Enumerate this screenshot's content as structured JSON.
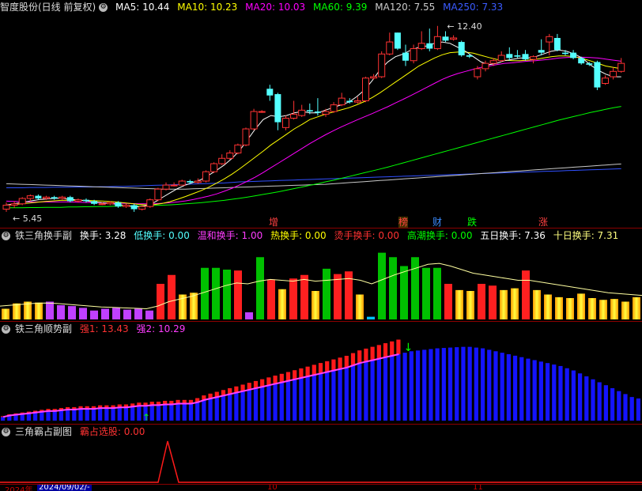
{
  "main_header": {
    "title": "智度股份(日线 前复权)",
    "ma5": "MA5: 10.44",
    "ma10": "MA10: 10.23",
    "ma20": "MA20: 10.03",
    "ma60": "MA60: 9.39",
    "ma120": "MA120: 7.55",
    "ma250": "MA250: 7.33"
  },
  "price_high_label": "12.40",
  "price_low_label": "5.45",
  "event_tags": [
    "增",
    "榜",
    "财",
    "跌",
    "涨"
  ],
  "panel1": {
    "title": "铁三角换手副",
    "huanshou": "换手: 3.28",
    "di": "低换手: 0.00",
    "wenhe": "温和换手: 1.00",
    "re": "热换手: 0.00",
    "tang": "烫手换手: 0.00",
    "gaochao": "高潮换手: 0.00",
    "wuri": "五日换手: 7.36",
    "shiri": "十日换手: 7.31"
  },
  "panel2": {
    "title": "铁三角顺势副",
    "qiang1": "强1: 13.43",
    "qiang2": "强2: 10.29"
  },
  "panel3": {
    "title": "三角霸占副图",
    "bazhan": "霸占选股: 0.00"
  },
  "axis": {
    "year_label": "2024年",
    "date_box": "2024/09/02/-",
    "tick_oct": "10",
    "tick_nov": "11"
  },
  "colors": {
    "up": "#ff3232",
    "down": "#54ffff",
    "ma5": "#ffffff",
    "ma10": "#ffff00",
    "ma20": "#ff00ff",
    "ma60": "#00ff00",
    "ma120": "#c8c8c8",
    "ma250": "#3050ff"
  },
  "candles": [
    {
      "o": 5.55,
      "c": 5.7,
      "h": 5.8,
      "l": 5.45
    },
    {
      "o": 5.7,
      "c": 5.75,
      "h": 5.85,
      "l": 5.6
    },
    {
      "o": 5.75,
      "c": 5.95,
      "h": 6.0,
      "l": 5.7
    },
    {
      "o": 5.95,
      "c": 6.05,
      "h": 6.1,
      "l": 5.85
    },
    {
      "o": 6.05,
      "c": 5.95,
      "h": 6.1,
      "l": 5.9
    },
    {
      "o": 5.95,
      "c": 6.0,
      "h": 6.05,
      "l": 5.9
    },
    {
      "o": 6.0,
      "c": 5.95,
      "h": 6.05,
      "l": 5.9
    },
    {
      "o": 5.95,
      "c": 6.0,
      "h": 6.05,
      "l": 5.9
    },
    {
      "o": 6.0,
      "c": 5.85,
      "h": 6.05,
      "l": 5.8
    },
    {
      "o": 5.85,
      "c": 5.9,
      "h": 5.95,
      "l": 5.8
    },
    {
      "o": 5.9,
      "c": 5.85,
      "h": 5.95,
      "l": 5.8
    },
    {
      "o": 5.85,
      "c": 5.75,
      "h": 5.9,
      "l": 5.7
    },
    {
      "o": 5.75,
      "c": 5.75,
      "h": 5.8,
      "l": 5.7
    },
    {
      "o": 5.75,
      "c": 5.8,
      "h": 5.85,
      "l": 5.7
    },
    {
      "o": 5.8,
      "c": 5.65,
      "h": 5.85,
      "l": 5.6
    },
    {
      "o": 5.65,
      "c": 5.7,
      "h": 5.75,
      "l": 5.6
    },
    {
      "o": 5.7,
      "c": 5.55,
      "h": 5.75,
      "l": 5.45
    },
    {
      "o": 5.55,
      "c": 5.65,
      "h": 5.7,
      "l": 5.5
    },
    {
      "o": 5.65,
      "c": 5.9,
      "h": 5.95,
      "l": 5.6
    },
    {
      "o": 5.9,
      "c": 6.3,
      "h": 6.35,
      "l": 5.85
    },
    {
      "o": 6.3,
      "c": 6.45,
      "h": 6.55,
      "l": 6.25
    },
    {
      "o": 6.45,
      "c": 6.45,
      "h": 6.55,
      "l": 6.4
    },
    {
      "o": 6.45,
      "c": 6.6,
      "h": 6.65,
      "l": 6.45
    },
    {
      "o": 6.6,
      "c": 6.55,
      "h": 6.65,
      "l": 6.5
    },
    {
      "o": 6.55,
      "c": 6.6,
      "h": 6.7,
      "l": 6.5
    },
    {
      "o": 6.6,
      "c": 6.95,
      "h": 7.0,
      "l": 6.55
    },
    {
      "o": 6.95,
      "c": 7.25,
      "h": 7.3,
      "l": 6.9
    },
    {
      "o": 7.25,
      "c": 7.45,
      "h": 7.6,
      "l": 7.2
    },
    {
      "o": 7.45,
      "c": 7.65,
      "h": 7.75,
      "l": 7.4
    },
    {
      "o": 7.65,
      "c": 7.95,
      "h": 8.0,
      "l": 7.6
    },
    {
      "o": 7.95,
      "c": 8.55,
      "h": 8.6,
      "l": 7.9
    },
    {
      "o": 8.55,
      "c": 9.2,
      "h": 9.3,
      "l": 8.5
    },
    {
      "o": 9.2,
      "c": 9.2,
      "h": 9.25,
      "l": 9.15
    },
    {
      "o": 10.05,
      "c": 9.8,
      "h": 10.2,
      "l": 9.6
    },
    {
      "o": 9.85,
      "c": 8.8,
      "h": 9.9,
      "l": 8.5
    },
    {
      "o": 8.6,
      "c": 8.95,
      "h": 9.05,
      "l": 8.5
    },
    {
      "o": 8.95,
      "c": 9.1,
      "h": 9.6,
      "l": 8.9
    },
    {
      "o": 9.05,
      "c": 9.25,
      "h": 9.45,
      "l": 9.0
    },
    {
      "o": 9.25,
      "c": 9.2,
      "h": 9.5,
      "l": 9.1
    },
    {
      "o": 9.2,
      "c": 9.15,
      "h": 9.7,
      "l": 9.05
    },
    {
      "o": 9.1,
      "c": 9.2,
      "h": 9.3,
      "l": 9.0
    },
    {
      "o": 9.2,
      "c": 9.45,
      "h": 9.55,
      "l": 9.15
    },
    {
      "o": 9.45,
      "c": 9.7,
      "h": 9.9,
      "l": 9.4
    },
    {
      "o": 9.6,
      "c": 9.55,
      "h": 9.7,
      "l": 9.5
    },
    {
      "o": 9.55,
      "c": 9.6,
      "h": 9.75,
      "l": 9.5
    },
    {
      "o": 9.6,
      "c": 10.45,
      "h": 10.5,
      "l": 9.55
    },
    {
      "o": 10.45,
      "c": 10.5,
      "h": 10.6,
      "l": 10.4
    },
    {
      "o": 10.5,
      "c": 11.35,
      "h": 11.45,
      "l": 10.45
    },
    {
      "o": 11.35,
      "c": 11.8,
      "h": 12.15,
      "l": 11.3
    },
    {
      "o": 12.15,
      "c": 11.55,
      "h": 12.15,
      "l": 11.5
    },
    {
      "o": 11.4,
      "c": 11.1,
      "h": 11.7,
      "l": 10.9
    },
    {
      "o": 11.1,
      "c": 11.55,
      "h": 11.7,
      "l": 11.0
    },
    {
      "o": 11.55,
      "c": 11.75,
      "h": 12.2,
      "l": 11.5
    },
    {
      "o": 11.75,
      "c": 11.55,
      "h": 12.3,
      "l": 11.45
    },
    {
      "o": 11.55,
      "c": 12.0,
      "h": 12.4,
      "l": 11.5
    },
    {
      "o": 12.0,
      "c": 11.85,
      "h": 12.2,
      "l": 11.8
    },
    {
      "o": 11.9,
      "c": 11.95,
      "h": 12.05,
      "l": 11.85
    },
    {
      "o": 11.8,
      "c": 11.3,
      "h": 11.85,
      "l": 11.25
    },
    {
      "o": 11.3,
      "c": 11.25,
      "h": 11.35,
      "l": 11.2
    },
    {
      "o": 10.5,
      "c": 10.8,
      "h": 10.9,
      "l": 10.4
    },
    {
      "o": 10.8,
      "c": 11.0,
      "h": 11.1,
      "l": 10.7
    },
    {
      "o": 11.0,
      "c": 11.1,
      "h": 11.2,
      "l": 10.9
    },
    {
      "o": 11.1,
      "c": 11.3,
      "h": 11.45,
      "l": 11.05
    },
    {
      "o": 11.35,
      "c": 11.2,
      "h": 11.6,
      "l": 11.1
    },
    {
      "o": 11.3,
      "c": 11.25,
      "h": 11.5,
      "l": 11.2
    },
    {
      "o": 11.35,
      "c": 11.15,
      "h": 11.5,
      "l": 11.1
    },
    {
      "o": 11.15,
      "c": 11.25,
      "h": 11.3,
      "l": 11.0
    },
    {
      "o": 11.5,
      "c": 11.4,
      "h": 11.9,
      "l": 11.3
    },
    {
      "o": 11.8,
      "c": 12.0,
      "h": 12.1,
      "l": 11.3
    },
    {
      "o": 11.95,
      "c": 11.5,
      "h": 12.1,
      "l": 11.45
    },
    {
      "o": 11.4,
      "c": 11.35,
      "h": 11.5,
      "l": 11.3
    },
    {
      "o": 11.4,
      "c": 11.2,
      "h": 11.5,
      "l": 11.15
    },
    {
      "o": 11.2,
      "c": 11.0,
      "h": 11.25,
      "l": 10.95
    },
    {
      "o": 11.0,
      "c": 10.95,
      "h": 11.05,
      "l": 10.9
    },
    {
      "o": 11.05,
      "c": 10.1,
      "h": 11.1,
      "l": 10.0
    },
    {
      "o": 10.25,
      "c": 10.45,
      "h": 10.55,
      "l": 10.2
    },
    {
      "o": 10.5,
      "c": 10.7,
      "h": 10.85,
      "l": 10.4
    },
    {
      "o": 10.7,
      "c": 11.0,
      "h": 11.2,
      "l": 10.65
    }
  ],
  "ma_lines": {
    "ma5": [
      5.7,
      5.75,
      5.8,
      5.85,
      5.9,
      5.93,
      5.95,
      5.96,
      5.92,
      5.9,
      5.87,
      5.83,
      5.8,
      5.77,
      5.74,
      5.7,
      5.66,
      5.64,
      5.68,
      5.8,
      5.98,
      6.15,
      6.32,
      6.45,
      6.55,
      6.65,
      6.82,
      7.0,
      7.2,
      7.45,
      7.75,
      8.15,
      8.55,
      8.9,
      9.05,
      9.0,
      9.05,
      9.15,
      9.2,
      9.15,
      9.15,
      9.25,
      9.35,
      9.45,
      9.55,
      9.75,
      10.0,
      10.35,
      10.75,
      11.05,
      11.25,
      11.35,
      11.5,
      11.6,
      11.65,
      11.75,
      11.8,
      11.75,
      11.6,
      11.45,
      11.25,
      11.05,
      10.95,
      11.0,
      11.1,
      11.15,
      11.2,
      11.2,
      11.25,
      11.35,
      11.45,
      11.5,
      11.45,
      11.35,
      11.2,
      10.95,
      10.75,
      10.6,
      10.5,
      10.5
    ],
    "ma10": [
      5.7,
      5.72,
      5.75,
      5.78,
      5.81,
      5.84,
      5.86,
      5.88,
      5.88,
      5.88,
      5.88,
      5.87,
      5.86,
      5.84,
      5.82,
      5.79,
      5.76,
      5.73,
      5.71,
      5.72,
      5.76,
      5.83,
      5.92,
      6.02,
      6.13,
      6.24,
      6.37,
      6.52,
      6.68,
      6.86,
      7.06,
      7.28,
      7.5,
      7.72,
      7.95,
      8.15,
      8.35,
      8.55,
      8.72,
      8.9,
      9.0,
      9.1,
      9.18,
      9.26,
      9.34,
      9.45,
      9.57,
      9.72,
      9.9,
      10.1,
      10.3,
      10.5,
      10.7,
      10.9,
      11.05,
      11.2,
      11.32,
      11.4,
      11.42,
      11.42,
      11.38,
      11.3,
      11.22,
      11.15,
      11.12,
      11.1,
      11.1,
      11.12,
      11.15,
      11.2,
      11.25,
      11.28,
      11.28,
      11.25,
      11.18,
      11.1,
      11.0,
      10.9,
      10.85,
      10.8
    ],
    "ma20": [
      5.85,
      5.84,
      5.83,
      5.82,
      5.82,
      5.82,
      5.82,
      5.82,
      5.82,
      5.81,
      5.8,
      5.8,
      5.79,
      5.78,
      5.77,
      5.77,
      5.76,
      5.75,
      5.75,
      5.75,
      5.77,
      5.79,
      5.82,
      5.86,
      5.91,
      5.97,
      6.04,
      6.12,
      6.22,
      6.33,
      6.46,
      6.6,
      6.75,
      6.92,
      7.1,
      7.28,
      7.46,
      7.64,
      7.82,
      8.0,
      8.17,
      8.33,
      8.48,
      8.62,
      8.75,
      8.88,
      9.0,
      9.12,
      9.25,
      9.38,
      9.52,
      9.66,
      9.8,
      9.95,
      10.1,
      10.25,
      10.4,
      10.52,
      10.62,
      10.7,
      10.78,
      10.85,
      10.9,
      10.95,
      11.0,
      11.02,
      11.05,
      11.08,
      11.1,
      11.13,
      11.16,
      11.2,
      11.22,
      11.23,
      11.23,
      11.22,
      11.2,
      11.16,
      11.12,
      11.08
    ],
    "ma60": [
      5.6,
      5.6,
      5.6,
      5.61,
      5.61,
      5.62,
      5.62,
      5.62,
      5.63,
      5.63,
      5.64,
      5.64,
      5.65,
      5.65,
      5.66,
      5.66,
      5.67,
      5.67,
      5.68,
      5.69,
      5.7,
      5.71,
      5.73,
      5.75,
      5.77,
      5.79,
      5.82,
      5.85,
      5.88,
      5.92,
      5.96,
      6.0,
      6.05,
      6.1,
      6.15,
      6.2,
      6.26,
      6.32,
      6.38,
      6.44,
      6.5,
      6.57,
      6.63,
      6.7,
      6.77,
      6.84,
      6.91,
      6.98,
      7.05,
      7.12,
      7.2,
      7.28,
      7.36,
      7.44,
      7.52,
      7.6,
      7.68,
      7.76,
      7.84,
      7.92,
      8.0,
      8.08,
      8.16,
      8.24,
      8.32,
      8.4,
      8.48,
      8.56,
      8.64,
      8.72,
      8.8,
      8.88,
      8.95,
      9.02,
      9.09,
      9.16,
      9.22,
      9.28,
      9.34,
      9.39
    ],
    "ma120": [
      6.5,
      6.49,
      6.48,
      6.47,
      6.46,
      6.45,
      6.44,
      6.43,
      6.42,
      6.41,
      6.4,
      6.39,
      6.38,
      6.37,
      6.36,
      6.35,
      6.34,
      6.33,
      6.32,
      6.31,
      6.3,
      6.3,
      6.3,
      6.3,
      6.31,
      6.32,
      6.33,
      6.34,
      6.35,
      6.36,
      6.37,
      6.38,
      6.39,
      6.4,
      6.41,
      6.42,
      6.43,
      6.44,
      6.45,
      6.46,
      6.47,
      6.48,
      6.5,
      6.52,
      6.54,
      6.56,
      6.58,
      6.6,
      6.62,
      6.64,
      6.66,
      6.68,
      6.7,
      6.72,
      6.74,
      6.76,
      6.78,
      6.8,
      6.82,
      6.84,
      6.86,
      6.88,
      6.9,
      6.92,
      6.94,
      6.96,
      6.98,
      7.0,
      7.02,
      7.04,
      7.06,
      7.08,
      7.1,
      7.12,
      7.14,
      7.16,
      7.18,
      7.2,
      7.22,
      7.24
    ],
    "ma250": [
      6.35,
      6.35,
      6.35,
      6.36,
      6.36,
      6.36,
      6.37,
      6.37,
      6.37,
      6.38,
      6.38,
      6.38,
      6.39,
      6.39,
      6.4,
      6.4,
      6.41,
      6.42,
      6.43,
      6.44,
      6.45,
      6.46,
      6.47,
      6.48,
      6.49,
      6.5,
      6.51,
      6.52,
      6.53,
      6.55,
      6.57,
      6.58,
      6.59,
      6.6,
      6.61,
      6.62,
      6.63,
      6.64,
      6.65,
      6.66,
      6.67,
      6.68,
      6.69,
      6.7,
      6.71,
      6.72,
      6.73,
      6.74,
      6.75,
      6.76,
      6.77,
      6.78,
      6.79,
      6.8,
      6.81,
      6.82,
      6.83,
      6.84,
      6.85,
      6.86,
      6.87,
      6.88,
      6.89,
      6.9,
      6.91,
      6.92,
      6.93,
      6.94,
      6.95,
      6.96,
      6.97,
      6.98,
      6.99,
      7.0,
      7.01,
      7.02,
      7.03,
      7.04,
      7.05,
      7.06
    ]
  },
  "turnover_bars": [
    {
      "v": 1.2,
      "c": "yellow"
    },
    {
      "v": 1.8,
      "c": "yellow"
    },
    {
      "v": 2.0,
      "c": "yellow"
    },
    {
      "v": 1.9,
      "c": "yellow"
    },
    {
      "v": 2.0,
      "c": "magenta"
    },
    {
      "v": 1.6,
      "c": "magenta"
    },
    {
      "v": 1.5,
      "c": "magenta"
    },
    {
      "v": 1.3,
      "c": "magenta"
    },
    {
      "v": 1.0,
      "c": "magenta"
    },
    {
      "v": 1.2,
      "c": "magenta"
    },
    {
      "v": 1.3,
      "c": "magenta"
    },
    {
      "v": 1.1,
      "c": "magenta"
    },
    {
      "v": 1.2,
      "c": "magenta"
    },
    {
      "v": 1.0,
      "c": "magenta"
    },
    {
      "v": 4.0,
      "c": "red"
    },
    {
      "v": 5.0,
      "c": "red"
    },
    {
      "v": 2.8,
      "c": "yellow"
    },
    {
      "v": 3.0,
      "c": "yellow"
    },
    {
      "v": 5.8,
      "c": "green"
    },
    {
      "v": 5.8,
      "c": "green"
    },
    {
      "v": 5.6,
      "c": "green"
    },
    {
      "v": 5.5,
      "c": "red"
    },
    {
      "v": 0.8,
      "c": "magenta"
    },
    {
      "v": 7.0,
      "c": "green"
    },
    {
      "v": 4.5,
      "c": "red"
    },
    {
      "v": 3.4,
      "c": "yellow"
    },
    {
      "v": 4.6,
      "c": "red"
    },
    {
      "v": 5.0,
      "c": "red"
    },
    {
      "v": 3.2,
      "c": "yellow"
    },
    {
      "v": 5.7,
      "c": "green"
    },
    {
      "v": 5.1,
      "c": "red"
    },
    {
      "v": 5.4,
      "c": "red"
    },
    {
      "v": 2.8,
      "c": "yellow"
    },
    {
      "v": 0.3,
      "c": "cyan"
    },
    {
      "v": 7.5,
      "c": "green"
    },
    {
      "v": 7.0,
      "c": "green"
    },
    {
      "v": 6.0,
      "c": "green"
    },
    {
      "v": 7.0,
      "c": "green"
    },
    {
      "v": 5.8,
      "c": "green"
    },
    {
      "v": 5.8,
      "c": "green"
    },
    {
      "v": 4.0,
      "c": "red"
    },
    {
      "v": 3.3,
      "c": "yellow"
    },
    {
      "v": 3.2,
      "c": "yellow"
    },
    {
      "v": 4.0,
      "c": "red"
    },
    {
      "v": 3.8,
      "c": "red"
    },
    {
      "v": 3.3,
      "c": "yellow"
    },
    {
      "v": 3.5,
      "c": "yellow"
    },
    {
      "v": 5.5,
      "c": "red"
    },
    {
      "v": 3.3,
      "c": "yellow"
    },
    {
      "v": 2.8,
      "c": "yellow"
    },
    {
      "v": 2.5,
      "c": "yellow"
    },
    {
      "v": 2.4,
      "c": "yellow"
    },
    {
      "v": 2.9,
      "c": "yellow"
    },
    {
      "v": 2.4,
      "c": "yellow"
    },
    {
      "v": 2.2,
      "c": "yellow"
    },
    {
      "v": 2.3,
      "c": "yellow"
    },
    {
      "v": 2.0,
      "c": "yellow"
    },
    {
      "v": 2.5,
      "c": "yellow"
    }
  ],
  "turnover_line": [
    1.5,
    1.6,
    1.7,
    1.8,
    1.85,
    1.8,
    1.7,
    1.6,
    1.5,
    1.4,
    1.35,
    1.3,
    1.25,
    1.2,
    1.5,
    2.0,
    2.3,
    2.6,
    3.0,
    3.4,
    3.8,
    4.1,
    4.0,
    4.3,
    4.5,
    4.4,
    4.3,
    4.5,
    4.3,
    4.4,
    4.5,
    4.6,
    4.4,
    4.0,
    4.5,
    5.0,
    5.4,
    5.8,
    6.2,
    6.3,
    6.0,
    5.6,
    5.2,
    5.0,
    4.8,
    4.6,
    4.4,
    4.4,
    4.2,
    4.0,
    3.8,
    3.6,
    3.4,
    3.2,
    3.0,
    2.9,
    2.8,
    2.7
  ],
  "trend_bars": [
    0.5,
    0.7,
    0.8,
    0.9,
    1.0,
    1.1,
    1.2,
    1.3,
    1.3,
    1.4,
    1.5,
    1.5,
    1.6,
    1.6,
    1.6,
    1.7,
    1.7,
    1.7,
    1.8,
    1.8,
    1.9,
    2.0,
    2.0,
    2.1,
    2.1,
    2.2,
    2.2,
    2.3,
    2.3,
    2.3,
    2.5,
    2.8,
    3.0,
    3.2,
    3.4,
    3.6,
    3.8,
    4.0,
    4.2,
    4.4,
    4.6,
    4.8,
    5.0,
    5.2,
    5.4,
    5.6,
    5.8,
    6.0,
    6.2,
    6.4,
    6.6,
    6.8,
    7.0,
    7.2,
    7.5,
    7.8,
    8.0,
    8.2,
    8.4,
    8.6,
    8.8,
    9.0,
    9.2,
    9.4,
    9.5,
    9.6,
    9.7,
    9.8,
    9.85,
    9.9,
    9.95,
    10.0,
    10.0,
    9.9,
    9.8,
    9.6,
    9.4,
    9.2,
    9.0,
    8.8,
    8.6,
    8.4,
    8.2,
    8.0,
    7.8,
    7.6,
    7.4,
    7.1,
    6.8,
    6.4,
    6.0,
    5.6,
    5.2,
    4.8,
    4.4,
    4.0,
    3.6,
    3.2,
    3.0
  ]
}
